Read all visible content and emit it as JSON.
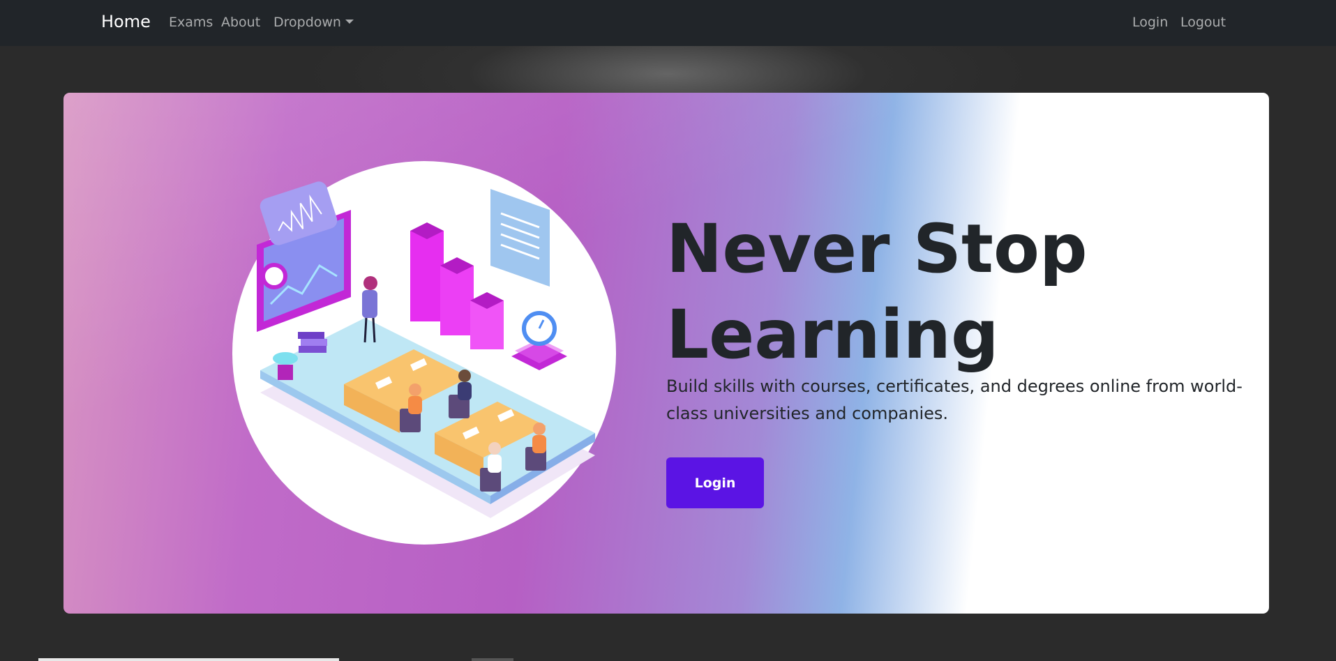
{
  "nav": {
    "brand": "Home",
    "links": [
      "Exams",
      "About",
      "Dropdown"
    ],
    "right_links": [
      "Login",
      "Logout"
    ]
  },
  "hero": {
    "title": "Never Stop Learning",
    "lead": "Build skills with courses, certificates, and degrees online from world-class universities and companies.",
    "button": "Login"
  },
  "colors": {
    "navbar": "#212529",
    "button": "#5b14e4",
    "text": "#212529"
  }
}
